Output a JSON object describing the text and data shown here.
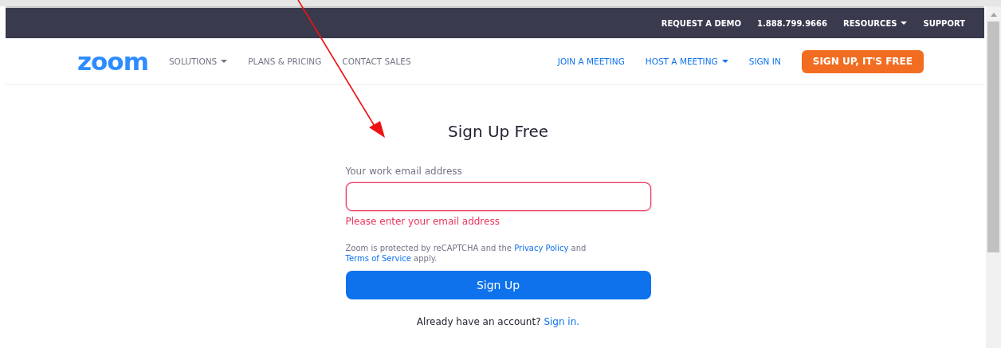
{
  "top_bar": {
    "items": [
      {
        "label": "REQUEST A DEMO",
        "dropdown": false
      },
      {
        "label": "1.888.799.9666",
        "dropdown": false
      },
      {
        "label": "RESOURCES",
        "dropdown": true
      },
      {
        "label": "SUPPORT",
        "dropdown": false
      }
    ]
  },
  "nav": {
    "logo": "zoom",
    "left_items": [
      {
        "label": "SOLUTIONS",
        "dropdown": true
      },
      {
        "label": "PLANS & PRICING",
        "dropdown": false
      },
      {
        "label": "CONTACT SALES",
        "dropdown": false
      }
    ],
    "right_items": [
      {
        "label": "JOIN A MEETING",
        "dropdown": false
      },
      {
        "label": "HOST A MEETING",
        "dropdown": true
      },
      {
        "label": "SIGN IN",
        "dropdown": false
      }
    ],
    "cta": "SIGN UP, IT'S FREE"
  },
  "form": {
    "title": "Sign Up Free",
    "label": "Your work email address",
    "invalid": true,
    "error": "Please enter your email address",
    "notice": [
      {
        "text": "Zoom is protected by reCAPTCHA and the ",
        "link": false
      },
      {
        "text": "Privacy Policy",
        "link": true
      },
      {
        "text": " and ",
        "link": false
      },
      {
        "text": "Terms of Service",
        "link": true
      },
      {
        "text": " apply.",
        "link": false
      }
    ],
    "submit": "Sign Up",
    "footer": [
      {
        "text": "Already have an account? ",
        "link": false
      },
      {
        "text": "Sign in.",
        "link": true
      }
    ]
  }
}
